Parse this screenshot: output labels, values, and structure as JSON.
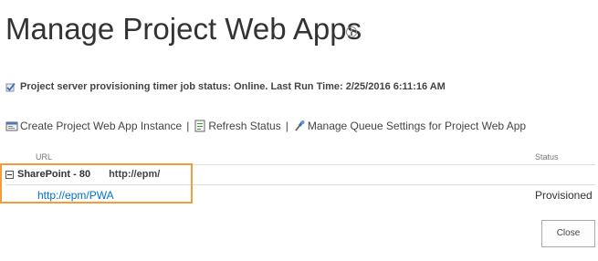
{
  "page": {
    "title": "Manage Project Web Apps"
  },
  "status_line": {
    "text": "Project server provisioning timer job status: Online. Last Run Time: 2/25/2016 6:11:16 AM"
  },
  "toolbar": {
    "create_label": "Create Project Web App Instance",
    "refresh_label": "Refresh Status",
    "queue_label": "Manage Queue Settings for Project Web App",
    "separator": "|"
  },
  "table": {
    "columns": {
      "url": "URL",
      "status": "Status"
    },
    "group": {
      "name": "SharePoint - 80",
      "url": "http://epm/"
    },
    "rows": [
      {
        "url": "http://epm/PWA",
        "status": "Provisioned"
      }
    ]
  },
  "footer": {
    "close_label": "Close"
  },
  "colors": {
    "highlight": "#f39c3c",
    "link": "#0072c6"
  }
}
